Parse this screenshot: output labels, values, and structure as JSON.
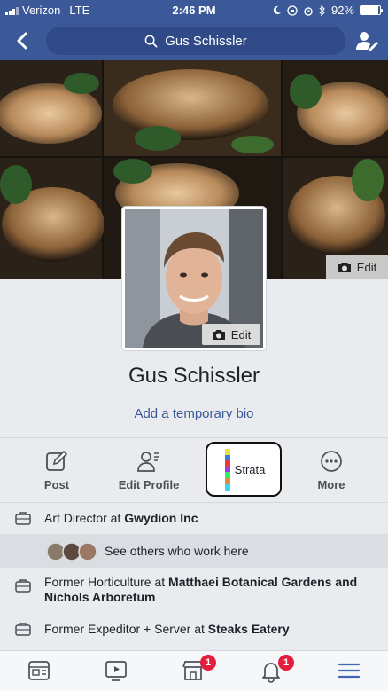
{
  "status_bar": {
    "carrier": "Verizon",
    "network": "LTE",
    "time": "2:46 PM",
    "battery": "92%",
    "battery_level": 0.92
  },
  "nav": {
    "search_text": "Gus Schissler",
    "icons": [
      "back-icon",
      "search-icon",
      "profile-edit-icon"
    ]
  },
  "cover": {
    "edit_label": "Edit"
  },
  "profile": {
    "name": "Gus Schissler",
    "photo_edit_label": "Edit",
    "bio_link": "Add a temporary bio"
  },
  "actions": [
    {
      "label": "Post",
      "icon": "compose-icon"
    },
    {
      "label": "Edit Profile",
      "icon": "edit-profile-icon"
    },
    {
      "label": "Strata",
      "icon": "strata-bar"
    },
    {
      "label": "More",
      "icon": "more-icon"
    }
  ],
  "about": {
    "job": {
      "prefix": "Art Director at ",
      "place": "Gwydion Inc"
    },
    "coworkers_label": "See others who work here",
    "former1": {
      "prefix": "Former Horticulture at ",
      "place": "Matthaei Botanical Gardens and Nichols Arboretum"
    },
    "former2": {
      "prefix": "Former Expeditor + Server at ",
      "place": "Steaks Eatery"
    }
  },
  "tab_bar": {
    "tabs": [
      "news-feed-icon",
      "watch-icon",
      "marketplace-icon",
      "notifications-icon",
      "menu-icon"
    ],
    "marketplace_badge": "1",
    "notifications_badge": "1"
  },
  "colors": {
    "brand": "#3b5998",
    "link": "#385898",
    "badge": "#e41e3f",
    "menu_active": "#4267b2"
  }
}
